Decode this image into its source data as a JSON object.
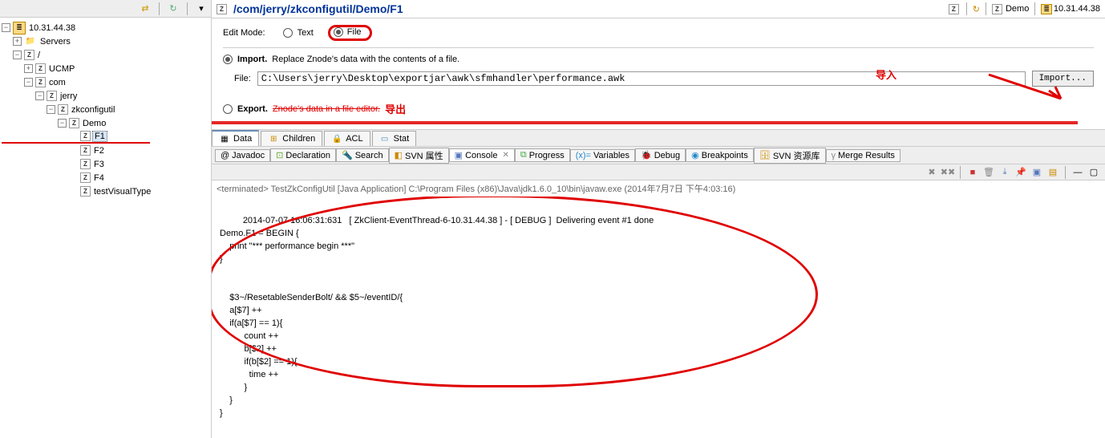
{
  "tree": {
    "root": "10.31.44.38",
    "servers": "Servers",
    "slash": "/",
    "ucmp": "UCMP",
    "com": "com",
    "jerry": "jerry",
    "zkconfigutil": "zkconfigutil",
    "demo": "Demo",
    "f1": "F1",
    "f2": "F2",
    "f3": "F3",
    "f4": "F4",
    "testVisualType": "testVisualType"
  },
  "header": {
    "path": "/com/jerry/zkconfigutil/Demo/F1",
    "head_demo": "Demo",
    "head_ip": "10.31.44.38"
  },
  "editor": {
    "edit_mode_label": "Edit Mode:",
    "text_label": "Text",
    "file_label": "File",
    "import_label": "Import.",
    "import_desc": "Replace Znode's data with the contents of a file.",
    "file_label2": "File:",
    "file_path": "C:\\Users\\jerry\\Desktop\\exportjar\\awk\\sfmhandler\\performance.awk",
    "import_btn": "Import...",
    "export_label": "Export.",
    "export_desc": "Znode's data in a file editor.",
    "annotation_import": "导入",
    "annotation_export": "导出"
  },
  "data_tabs": {
    "data": "Data",
    "children": "Children",
    "acl": "ACL",
    "stat": "Stat"
  },
  "views": {
    "javadoc": "Javadoc",
    "declaration": "Declaration",
    "search": "Search",
    "svn_prop": "SVN 属性",
    "console": "Console",
    "progress": "Progress",
    "variables": "Variables",
    "debug": "Debug",
    "breakpoints": "Breakpoints",
    "svn_repo": "SVN 资源库",
    "merge": "Merge Results"
  },
  "console": {
    "terminated": "<terminated> TestZkConfigUtil [Java Application] C:\\Program Files (x86)\\Java\\jdk1.6.0_10\\bin\\javaw.exe (2014年7月7日 下午4:03:16)",
    "output": "2014-07-07 16:06:31:631   [ ZkClient-EventThread-6-10.31.44.38 ] - [ DEBUG ]  Delivering event #1 done\nDemo.F1 = BEGIN {\n    print \"*** performance begin ***\"\n}\n\n\n    $3~/ResetableSenderBolt/ && $5~/eventID/{\n    a[$7] ++\n    if(a[$7] == 1){\n          count ++\n          b[$2] ++\n          if(b[$2] == 1){\n            time ++\n          }\n    }\n}"
  }
}
